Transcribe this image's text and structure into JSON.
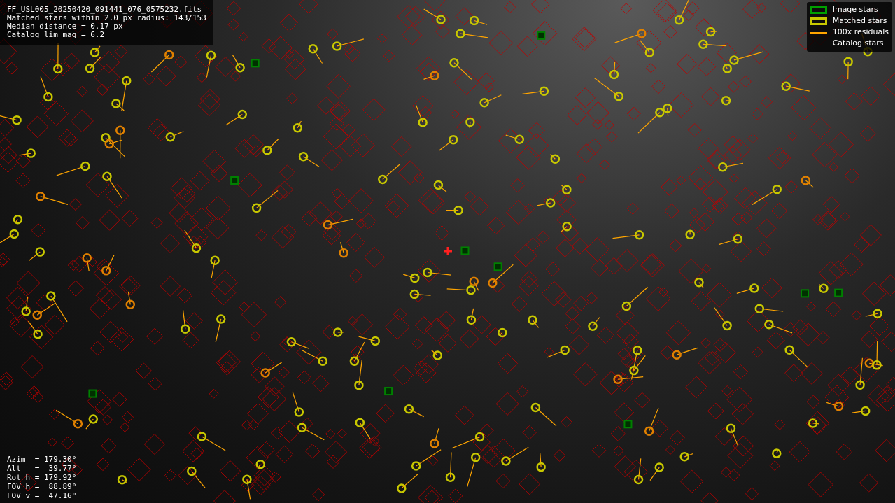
{
  "image_info": {
    "lines": [
      "FF_USL005_20250420_091441_076_0575232.fits",
      "Matched stars within 2.0 px radius: 143/153",
      "Median distance = 0.17 px",
      "Catalog lim mag = 6.2"
    ]
  },
  "legend": [
    {
      "kind": "box",
      "label": "Image stars",
      "color": "#00a000"
    },
    {
      "kind": "box",
      "label": "Matched stars",
      "color": "#c8c800"
    },
    {
      "kind": "line",
      "label": "100x residuals",
      "color": "#ffa500"
    },
    {
      "kind": "none",
      "label": "Catalog stars"
    }
  ],
  "pointing": {
    "lines": [
      "Azim  = 179.30°",
      "Alt   =  39.77°",
      "Rot h = 179.92°",
      "FOV h =  88.89°",
      "FOV v =  47.16°"
    ]
  }
}
